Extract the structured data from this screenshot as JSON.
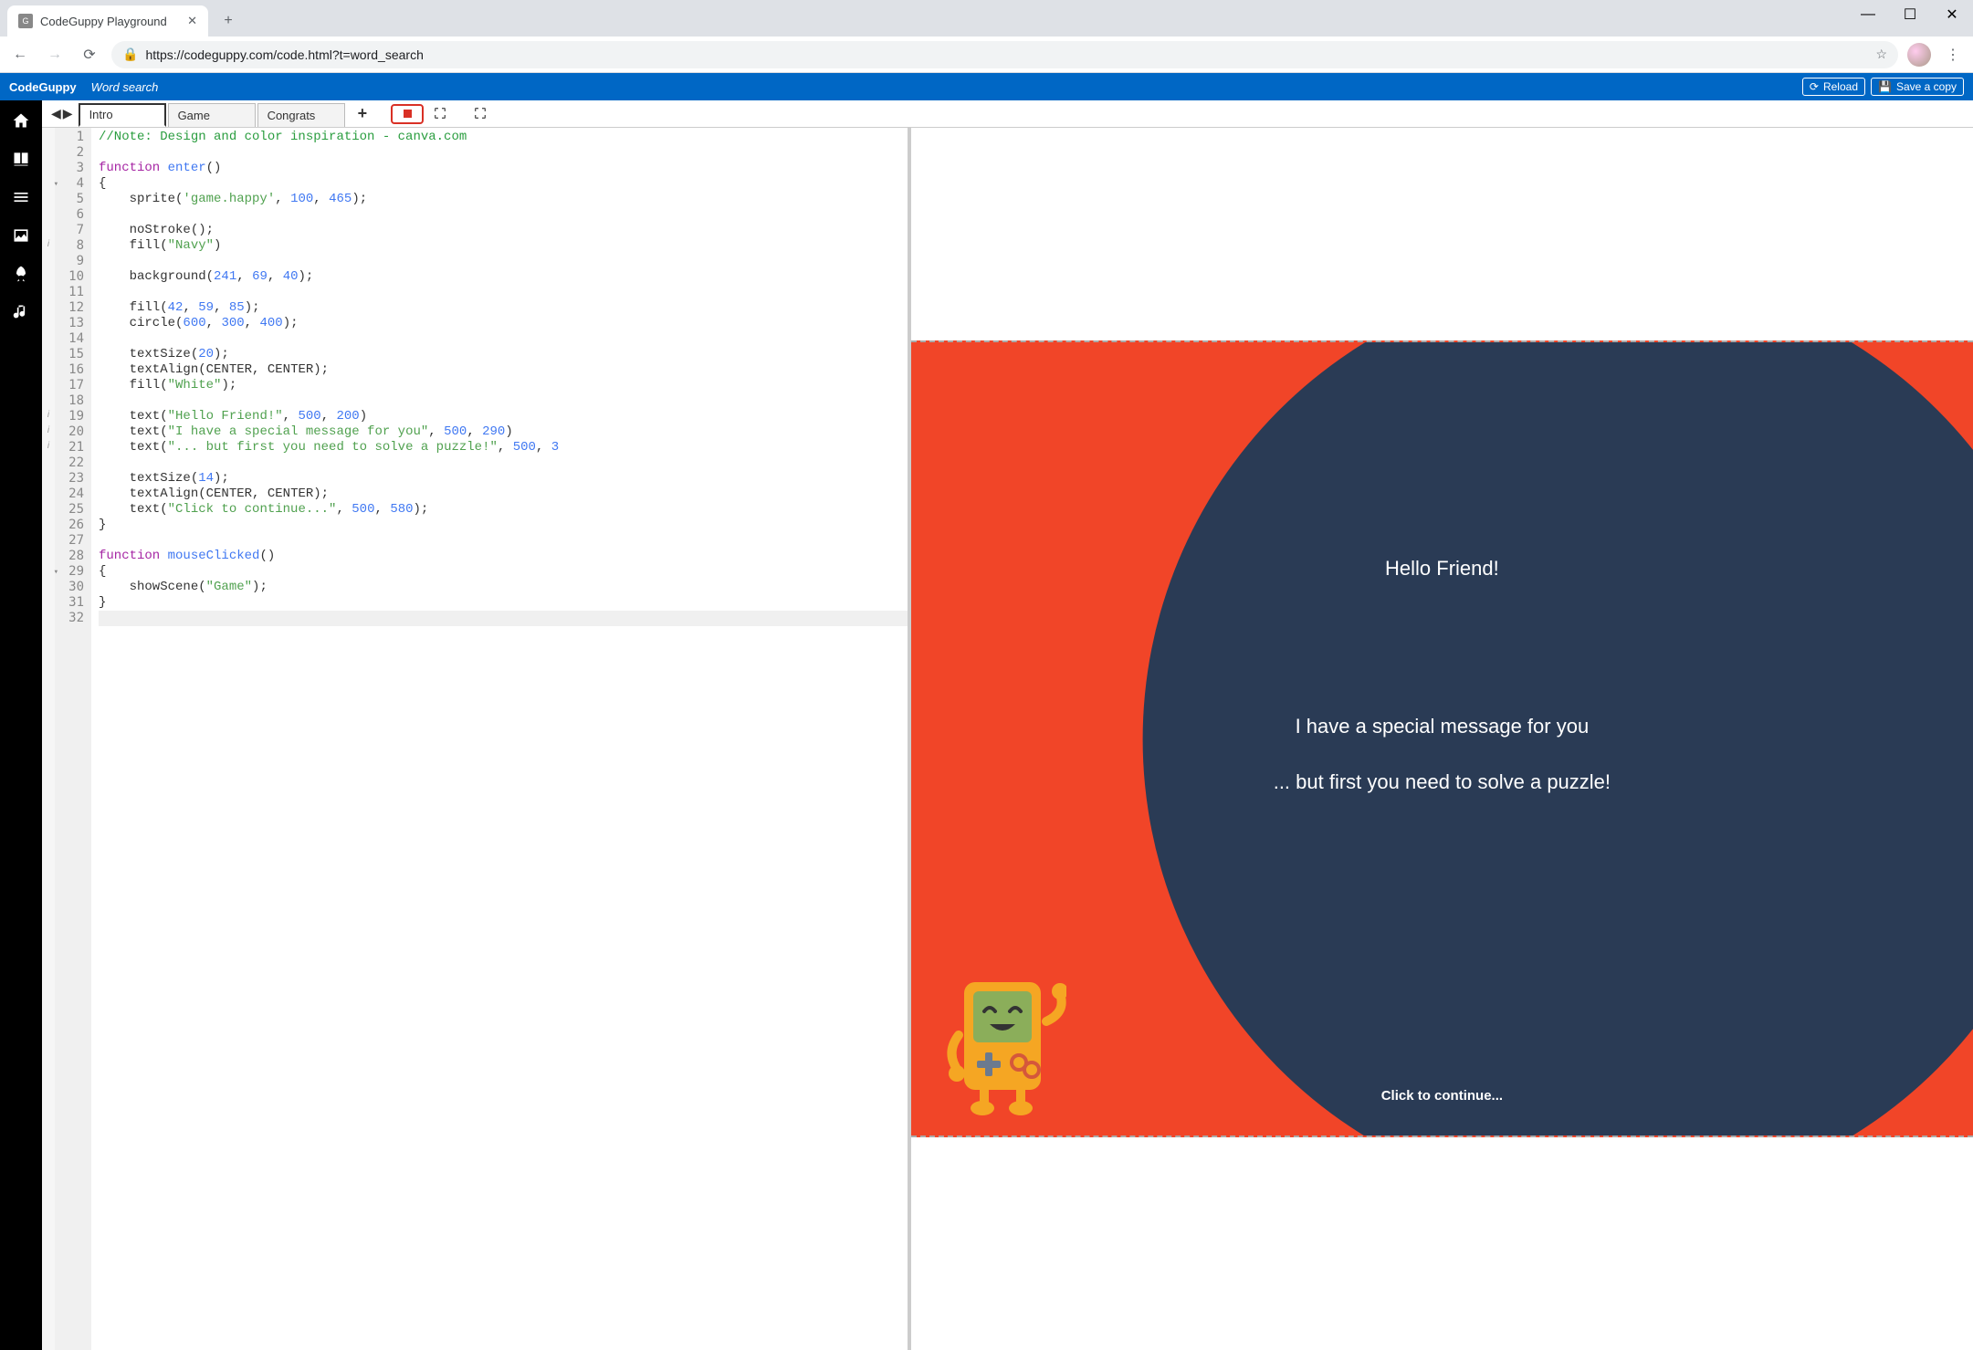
{
  "browser": {
    "tab_title": "CodeGuppy Playground",
    "url": "https://codeguppy.com/code.html?t=word_search"
  },
  "app": {
    "brand": "CodeGuppy",
    "project": "Word search",
    "reload": "Reload",
    "save_copy": "Save a copy"
  },
  "scenes": {
    "arrow_left": "◀",
    "arrow_right": "▶",
    "tabs": [
      "Intro",
      "Game",
      "Congrats"
    ],
    "active": 0
  },
  "editor": {
    "info_markers": {
      "8": "i",
      "19": "i",
      "20": "i",
      "21": "i"
    },
    "fold_lines": [
      4,
      29
    ],
    "line_count": 32,
    "lines": [
      {
        "t": "comment",
        "text": "//Note: Design and color inspiration - canva.com"
      },
      {
        "t": "blank",
        "text": ""
      },
      {
        "t": "fn_decl",
        "kw": "function",
        "name": "enter",
        "args": "()"
      },
      {
        "t": "brace",
        "text": "{"
      },
      {
        "t": "call",
        "indent": 1,
        "fn": "sprite",
        "args": [
          [
            "str",
            "'game.happy'"
          ],
          [
            "num",
            "100"
          ],
          [
            "num",
            "465"
          ]
        ]
      },
      {
        "t": "blank",
        "text": ""
      },
      {
        "t": "call",
        "indent": 1,
        "fn": "noStroke",
        "args": []
      },
      {
        "t": "call",
        "indent": 1,
        "fn": "fill",
        "args": [
          [
            "str",
            "\"Navy\""
          ]
        ],
        "nosemi": true
      },
      {
        "t": "blank",
        "text": ""
      },
      {
        "t": "call",
        "indent": 1,
        "fn": "background",
        "args": [
          [
            "num",
            "241"
          ],
          [
            "num",
            "69"
          ],
          [
            "num",
            "40"
          ]
        ]
      },
      {
        "t": "blank",
        "text": ""
      },
      {
        "t": "call",
        "indent": 1,
        "fn": "fill",
        "args": [
          [
            "num",
            "42"
          ],
          [
            "num",
            "59"
          ],
          [
            "num",
            "85"
          ]
        ]
      },
      {
        "t": "call",
        "indent": 1,
        "fn": "circle",
        "args": [
          [
            "num",
            "600"
          ],
          [
            "num",
            "300"
          ],
          [
            "num",
            "400"
          ]
        ]
      },
      {
        "t": "blank",
        "text": ""
      },
      {
        "t": "call",
        "indent": 1,
        "fn": "textSize",
        "args": [
          [
            "num",
            "20"
          ]
        ]
      },
      {
        "t": "call",
        "indent": 1,
        "fn": "textAlign",
        "args": [
          [
            "id",
            "CENTER"
          ],
          [
            "id",
            "CENTER"
          ]
        ]
      },
      {
        "t": "call",
        "indent": 1,
        "fn": "fill",
        "args": [
          [
            "str",
            "\"White\""
          ]
        ]
      },
      {
        "t": "blank",
        "text": ""
      },
      {
        "t": "call",
        "indent": 1,
        "fn": "text",
        "args": [
          [
            "str",
            "\"Hello Friend!\""
          ],
          [
            "num",
            "500"
          ],
          [
            "num",
            "200"
          ]
        ],
        "nosemi": true
      },
      {
        "t": "call",
        "indent": 1,
        "fn": "text",
        "args": [
          [
            "str",
            "\"I have a special message for you\""
          ],
          [
            "num",
            "500"
          ],
          [
            "num",
            "290"
          ]
        ],
        "nosemi": true
      },
      {
        "t": "call",
        "indent": 1,
        "fn": "text",
        "args": [
          [
            "str",
            "\"... but first you need to solve a puzzle!\""
          ],
          [
            "num",
            "500"
          ],
          [
            "num",
            "3"
          ]
        ],
        "trunc": true,
        "nosemi": true
      },
      {
        "t": "blank",
        "text": ""
      },
      {
        "t": "call",
        "indent": 1,
        "fn": "textSize",
        "args": [
          [
            "num",
            "14"
          ]
        ]
      },
      {
        "t": "call",
        "indent": 1,
        "fn": "textAlign",
        "args": [
          [
            "id",
            "CENTER"
          ],
          [
            "id",
            "CENTER"
          ]
        ]
      },
      {
        "t": "call",
        "indent": 1,
        "fn": "text",
        "args": [
          [
            "str",
            "\"Click to continue...\""
          ],
          [
            "num",
            "500"
          ],
          [
            "num",
            "580"
          ]
        ]
      },
      {
        "t": "brace",
        "text": "}"
      },
      {
        "t": "blank",
        "text": ""
      },
      {
        "t": "fn_decl",
        "kw": "function",
        "name": "mouseClicked",
        "args": "()"
      },
      {
        "t": "brace",
        "text": "{"
      },
      {
        "t": "call",
        "indent": 1,
        "fn": "showScene",
        "args": [
          [
            "str",
            "\"Game\""
          ]
        ]
      },
      {
        "t": "brace",
        "text": "}"
      },
      {
        "t": "blank",
        "text": "",
        "current": true
      }
    ]
  },
  "output": {
    "bg_color": "#f14528",
    "circle_color": "#2a3b55",
    "texts": [
      {
        "text": "Hello Friend!",
        "top": "27%",
        "size": "22px",
        "weight": "400"
      },
      {
        "text": "I have a special message for you",
        "top": "47%",
        "size": "22px",
        "weight": "400"
      },
      {
        "text": "... but first you need to solve a puzzle!",
        "top": "54%",
        "size": "22px",
        "weight": "400"
      },
      {
        "text": "Click to continue...",
        "top": "94%",
        "size": "15px",
        "weight": "bold"
      }
    ]
  }
}
